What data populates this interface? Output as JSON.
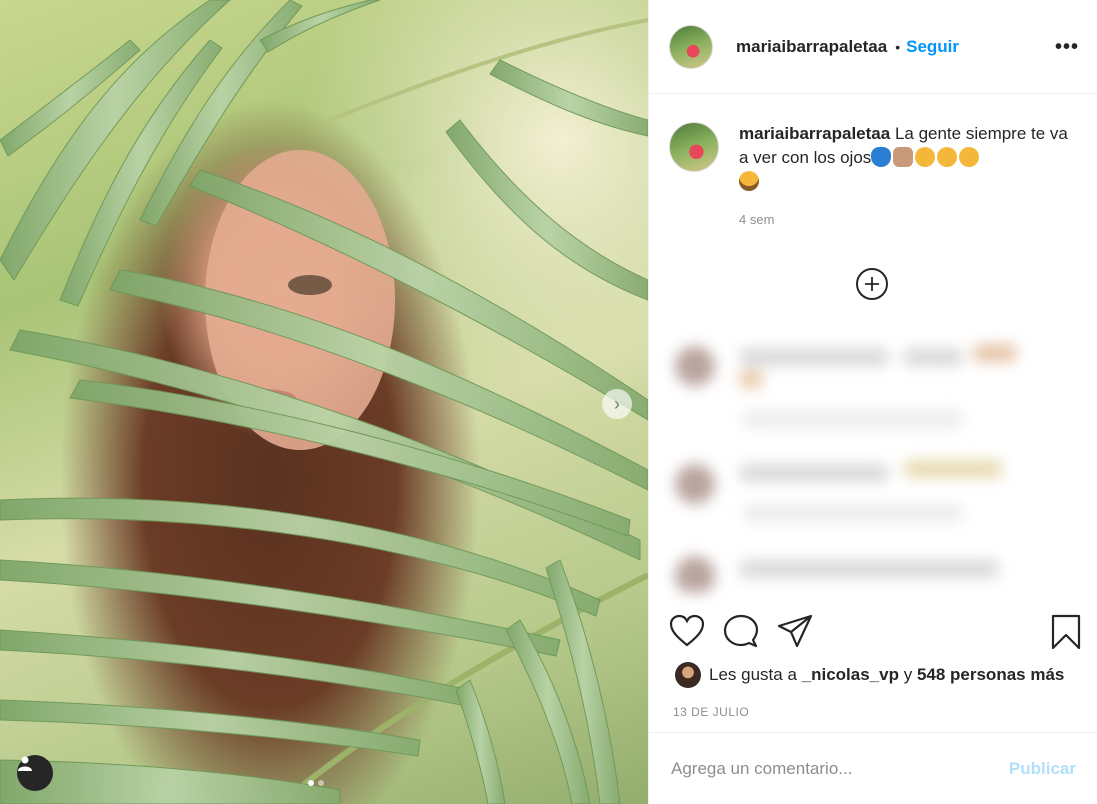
{
  "post": {
    "username": "mariaibarrapaletaa",
    "follow_label": "Seguir",
    "separator": "•",
    "more_label": "•••"
  },
  "caption": {
    "username": "mariaibarrapaletaa",
    "text": "La gente siempre te va a ver con los ojos",
    "emojis": [
      "blue-ufo-emoji",
      "sign-of-the-horns-emoji",
      "smirking-face-emoji",
      "hushed-face-emoji",
      "grinning-face-emoji",
      "astonished-face-emoji"
    ],
    "time": "4 sem"
  },
  "likes": {
    "prefix": "Les gusta a",
    "user": "_nicolas_vp",
    "connector": "y",
    "count_text": "548 personas más"
  },
  "date": "13 DE JULIO",
  "comment_box": {
    "placeholder": "Agrega un comentario...",
    "publish_label": "Publicar"
  },
  "carousel": {
    "current": 1,
    "total": 2
  },
  "colors": {
    "link": "#0095f6",
    "publish_disabled": "#b2dffc",
    "muted": "#8e8e8e",
    "text": "#262626"
  }
}
